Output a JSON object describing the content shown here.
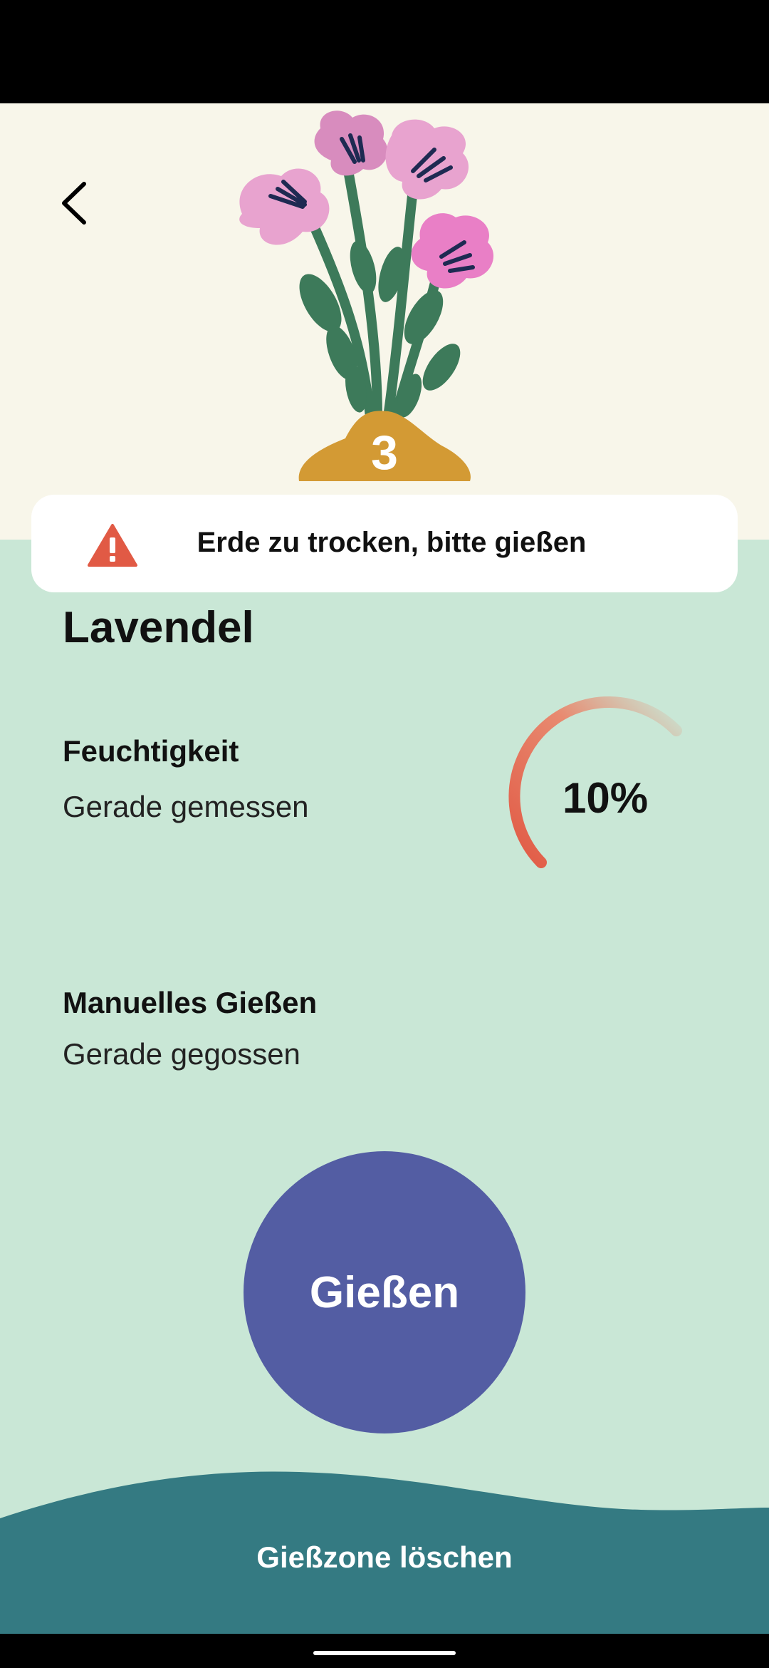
{
  "header": {
    "back_icon": "chevron-left-icon",
    "plant_illustration": "flower-bouquet-illustration",
    "zone_number": "3"
  },
  "alert": {
    "icon": "warning-triangle-icon",
    "text": "Erde zu trocken, bitte gießen",
    "color": "#e15a45"
  },
  "plant": {
    "name": "Lavendel"
  },
  "moisture": {
    "label": "Feuchtigkeit",
    "subtitle": "Gerade gemessen",
    "value_text": "10%",
    "value": 0.1,
    "gauge_color": "#e15a45"
  },
  "manual_watering": {
    "label": "Manuelles Gießen",
    "subtitle": "Gerade gegossen"
  },
  "actions": {
    "water_label": "Gießen",
    "delete_label": "Gießzone löschen"
  },
  "colors": {
    "hero_bg": "#f8f6ea",
    "main_bg": "#c9e7d6",
    "button": "#535da3",
    "footer": "#347a82"
  }
}
